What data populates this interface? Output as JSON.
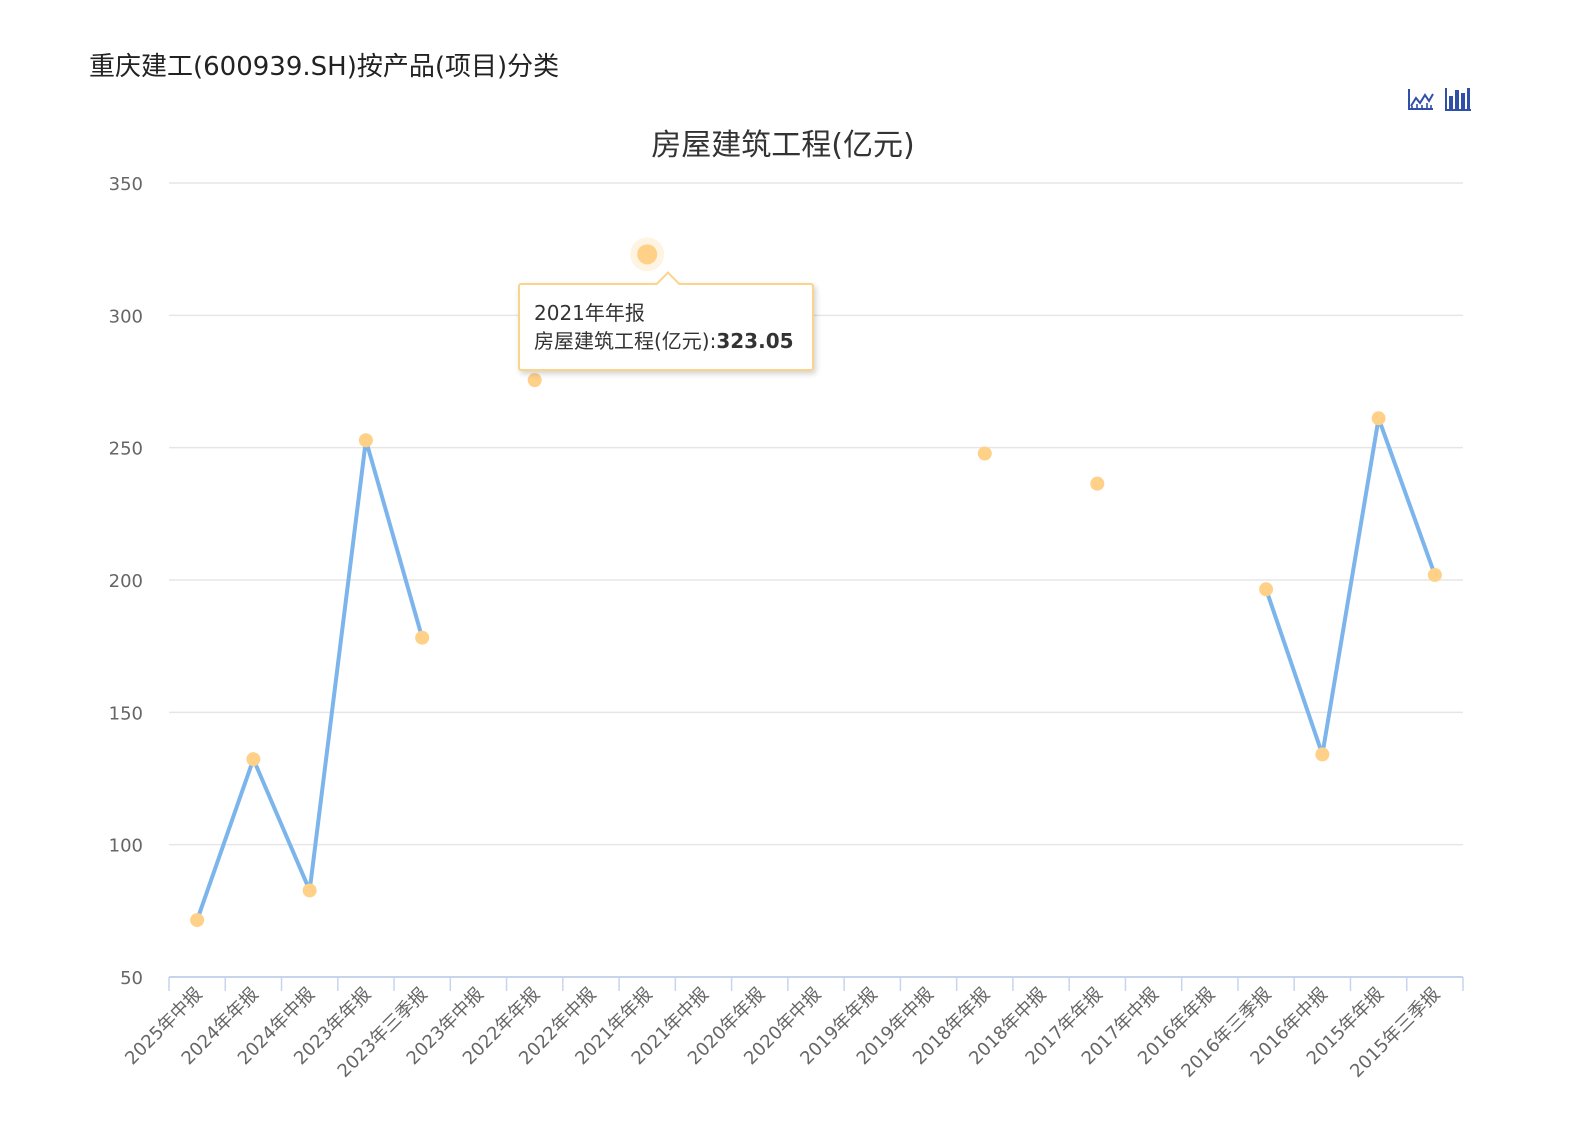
{
  "page": {
    "title": "重庆建工(600939.SH)按产品(项目)分类"
  },
  "toolbar": {
    "line_icon": "line-chart-icon",
    "bar_icon": "bar-chart-icon",
    "icon_color": "#2f4fa8"
  },
  "chart_data": {
    "type": "line",
    "title": "房屋建筑工程(亿元)",
    "xlabel": "",
    "ylabel": "",
    "ylim": [
      50,
      350
    ],
    "yticks": [
      50,
      100,
      150,
      200,
      250,
      300,
      350
    ],
    "grid": true,
    "categories": [
      "2025年中报",
      "2024年年报",
      "2024年中报",
      "2023年年报",
      "2023年三季报",
      "2023年中报",
      "2022年年报",
      "2022年中报",
      "2021年年报",
      "2021年中报",
      "2020年年报",
      "2020年中报",
      "2019年年报",
      "2019年中报",
      "2018年年报",
      "2018年中报",
      "2017年年报",
      "2017年中报",
      "2016年年报",
      "2016年三季报",
      "2016年中报",
      "2015年年报",
      "2015年三季报"
    ],
    "series": [
      {
        "name": "房屋建筑工程(亿元)",
        "color": "#7cb5ec",
        "marker_color": "#ffd088",
        "values": [
          71.5,
          132.3,
          82.7,
          252.8,
          178.2,
          null,
          275.5,
          null,
          323.05,
          null,
          null,
          null,
          null,
          null,
          247.8,
          null,
          236.4,
          null,
          null,
          196.5,
          134.1,
          261.1,
          201.9
        ]
      }
    ],
    "tooltip": {
      "category": "2021年年报",
      "label": "房屋建筑工程(亿元):",
      "value": "323.05"
    }
  }
}
